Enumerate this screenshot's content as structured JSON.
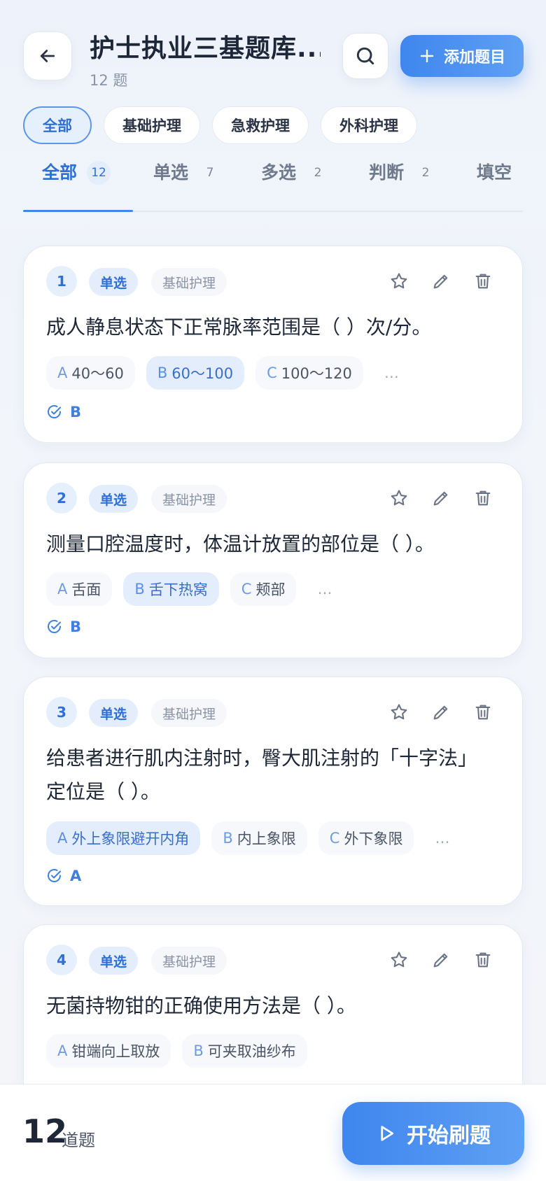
{
  "header": {
    "title": "护士执业三基题库...",
    "subtitle": "12 题",
    "add_label": "添加题目"
  },
  "chips": [
    {
      "label": "全部",
      "active": true
    },
    {
      "label": "基础护理",
      "active": false
    },
    {
      "label": "急救护理",
      "active": false
    },
    {
      "label": "外科护理",
      "active": false
    }
  ],
  "tabs": [
    {
      "label": "全部",
      "count": "12",
      "active": true
    },
    {
      "label": "单选",
      "count": "7",
      "active": false
    },
    {
      "label": "多选",
      "count": "2",
      "active": false
    },
    {
      "label": "判断",
      "count": "2",
      "active": false
    },
    {
      "label": "填空",
      "count": "",
      "active": false
    }
  ],
  "questions": [
    {
      "num": "1",
      "type": "单选",
      "category": "基础护理",
      "text": "成人静息状态下正常脉率范围是（ ）次/分。",
      "options": [
        {
          "letter": "A",
          "text": "40～60",
          "correct": false
        },
        {
          "letter": "B",
          "text": "60～100",
          "correct": true
        },
        {
          "letter": "C",
          "text": "100～120",
          "correct": false
        }
      ],
      "more": "…",
      "answer": "B"
    },
    {
      "num": "2",
      "type": "单选",
      "category": "基础护理",
      "text": "测量口腔温度时，体温计放置的部位是（ ）。",
      "options": [
        {
          "letter": "A",
          "text": "舌面",
          "correct": false
        },
        {
          "letter": "B",
          "text": "舌下热窝",
          "correct": true
        },
        {
          "letter": "C",
          "text": "颊部",
          "correct": false
        }
      ],
      "more": "…",
      "answer": "B"
    },
    {
      "num": "3",
      "type": "单选",
      "category": "基础护理",
      "text_line1": "给患者进行肌内注射时，臀大肌注射的「十字法」",
      "text_line2": "定位是（ ）。",
      "options": [
        {
          "letter": "A",
          "text": "外上象限避开内角",
          "correct": true
        },
        {
          "letter": "B",
          "text": "内上象限",
          "correct": false
        },
        {
          "letter": "C",
          "text": "外下象限",
          "correct": false
        }
      ],
      "more": "…",
      "answer": "A"
    },
    {
      "num": "4",
      "type": "单选",
      "category": "基础护理",
      "text": "无菌持物钳的正确使用方法是（ ）。",
      "options": [
        {
          "letter": "A",
          "text": "钳端向上取放",
          "correct": false
        },
        {
          "letter": "B",
          "text": "可夹取油纱布",
          "correct": false
        }
      ]
    }
  ],
  "footer": {
    "total": "12",
    "total_label": "道题",
    "start_label": "开始刷题"
  },
  "colors": {
    "accent": "#3f86ee",
    "accent_light": "#e3edfc",
    "text": "#1d2738"
  },
  "icons": [
    "back-arrow-icon",
    "search-icon",
    "plus-icon",
    "star-icon",
    "edit-pencil-icon",
    "trash-icon",
    "check-circle-icon",
    "play-icon"
  ]
}
